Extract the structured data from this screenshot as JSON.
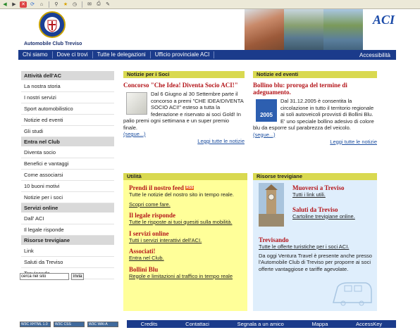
{
  "toolbar": {
    "icons": [
      "back-icon",
      "forward-icon",
      "stop-icon",
      "refresh-icon",
      "home-icon",
      "search-icon",
      "favorites-icon",
      "history-icon",
      "mail-icon",
      "print-icon",
      "edit-icon"
    ]
  },
  "header": {
    "club_name": "Automobile Club Treviso",
    "aci_logo": "ACI"
  },
  "nav": {
    "items": [
      "Chi siamo",
      "Dove ci trovi",
      "Tutte le delegazioni",
      "Ufficio provinciale ACI"
    ],
    "accessibility": "Accessibilità"
  },
  "sidebar": {
    "sections": [
      {
        "title": "Attività dell'AC",
        "items": [
          "La nostra storia",
          "I nostri servizi",
          "Sport automobilistico",
          "Notizie ed eventi",
          "Gli studi"
        ]
      },
      {
        "title": "Entra nel Club",
        "items": [
          "Diventa socio",
          "Benefici e vantaggi",
          "Come associarsi",
          "10 buoni motivi",
          "Notizie per i soci"
        ]
      },
      {
        "title": "Servizi online",
        "items": [
          "Dall' ACI",
          "Il legale risponde"
        ]
      },
      {
        "title": "Risorse trevigiane",
        "items": [
          "Link",
          "Saluti da Treviso",
          "Trevisando"
        ]
      }
    ],
    "search_placeholder": "cerca nel sito",
    "search_button": "invia"
  },
  "notizie_soci": {
    "header": "Notizie per i Soci",
    "title": "Concorso \"Che Idea! Diventa Socio ACI!\"",
    "body": "Dal 6 Giugno al 30 Settembre parte il concorso a premi \"CHE IDEA!DIVENTA SOCIO ACI!\" esteso a tutta la federazione e riservato ai soci Gold! In palio premi ogni settimana e un super premio finale.",
    "more": "(segue...)",
    "all": "Leggi tutte le notizie"
  },
  "notizie_eventi": {
    "header": "Notizie ed eventi",
    "title": "Bollino blu: proroga del termine di adeguamento.",
    "body": "Dal 31.12.2005 è consentita la circolazione in tutto il territorio regionale ai soli autoveicoli provvisti di Bollini Blu. E' uno speciale bollino adesivo di colore blu da esporre sul parabrezza del veicolo.",
    "more": "(segue...)",
    "all": "Leggi tutte le notizie",
    "thumb_year": "2005"
  },
  "utilita": {
    "header": "Utilità",
    "items": [
      {
        "title": "Prendi il nostro feed",
        "badge": "RSS",
        "desc": "Tutte le notizie del nostro sito in tempo reale.",
        "link": "Scopri come fare."
      },
      {
        "title": "Il legale risponde",
        "link": "Tutte le risposte ai tuoi quesiti sulla mobilità."
      },
      {
        "title": "I servizi online",
        "link": "Tutti i servizi interattivi dell'ACI."
      },
      {
        "title": "Associati!",
        "link": "Entra nel Club."
      },
      {
        "title": "Bollini Blu",
        "link": "Regole e limitazioni al traffico in tempo reale"
      }
    ]
  },
  "risorse": {
    "header": "Risorse trevigiane",
    "items": [
      {
        "title": "Muoversi a Treviso",
        "link": "Tutti i link utili."
      },
      {
        "title": "Saluti da Treviso",
        "link": "Cartoline trevigiane online."
      },
      {
        "title": "Trevisando",
        "link": "Tutte le offerte turistiche per i soci ACI.",
        "desc": "Da oggi Ventura Travel è presente anche presso l'Automobile Club di Treviso per proporre ai soci offerte vantaggiose e tariffe agevolate."
      }
    ]
  },
  "footer": {
    "badges": [
      "W3C XHTML 1.0",
      "W3C CSS",
      "W3C WAI-A"
    ],
    "links": [
      "Credits",
      "Contattaci",
      "Segnala a un amico",
      "Mappa",
      "AccessKey"
    ]
  },
  "colors": {
    "nav_bg": "#1b3b8b",
    "box_header": "#d9d950",
    "title_red": "#b4161b",
    "utilita_bg": "#ffff99",
    "risorse_bg": "#dfeefc"
  }
}
